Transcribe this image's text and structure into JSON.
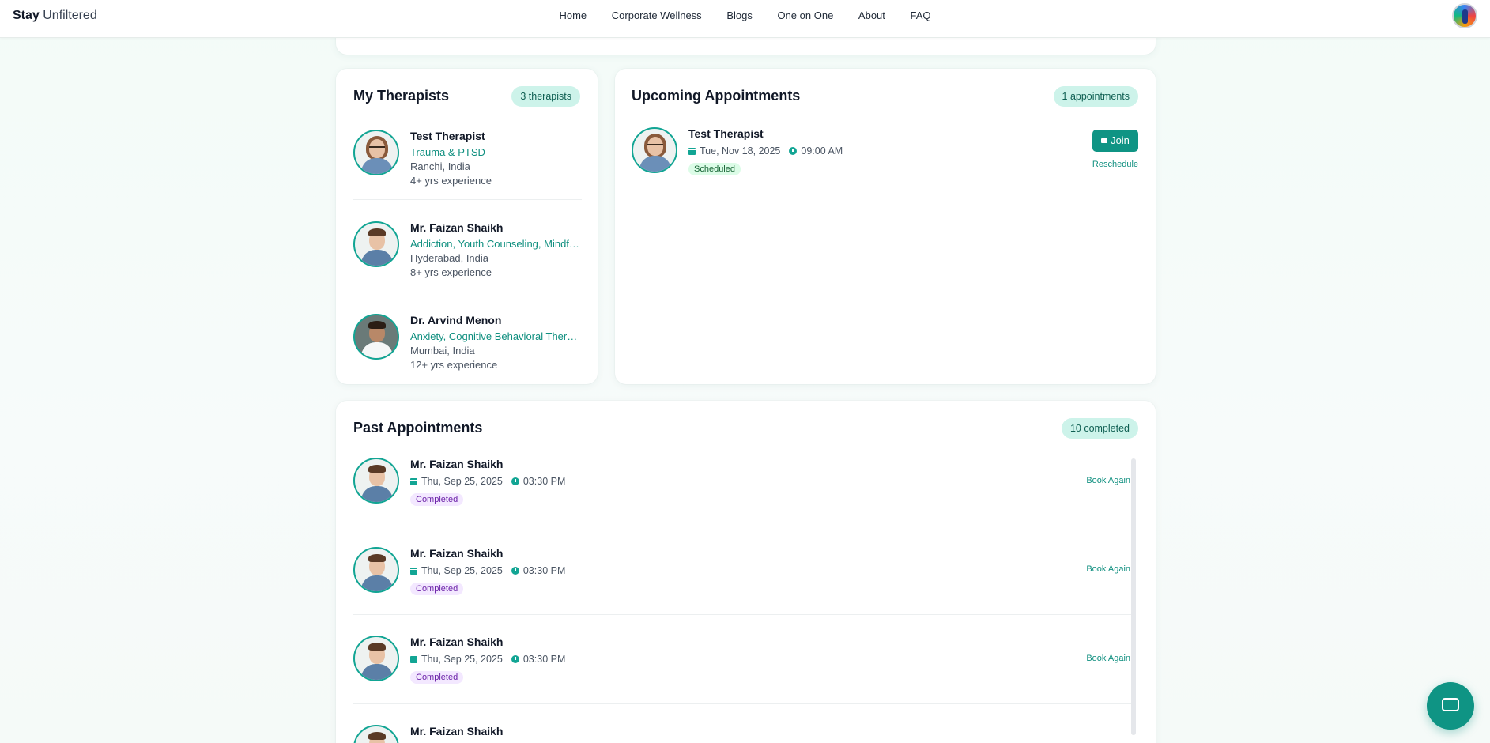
{
  "nav": {
    "brand_bold": "Stay",
    "brand_light": "Unfiltered",
    "links": [
      "Home",
      "Corporate Wellness",
      "Blogs",
      "One on One",
      "About",
      "FAQ"
    ]
  },
  "therapists": {
    "title": "My Therapists",
    "count_label": "3 therapists",
    "items": [
      {
        "name": "Test Therapist",
        "specialty": "Trauma & PTSD",
        "location": "Ranchi, India",
        "experience": "4+ yrs experience"
      },
      {
        "name": "Mr. Faizan Shaikh",
        "specialty": "Addiction, Youth Counseling, Mindfulness",
        "location": "Hyderabad, India",
        "experience": "8+ yrs experience"
      },
      {
        "name": "Dr. Arvind Menon",
        "specialty": "Anxiety, Cognitive Behavioral Therapy",
        "location": "Mumbai, India",
        "experience": "12+ yrs experience"
      }
    ]
  },
  "upcoming": {
    "title": "Upcoming Appointments",
    "count_label": "1 appointments",
    "items": [
      {
        "name": "Test Therapist",
        "date": "Tue, Nov 18, 2025",
        "time": "09:00 AM",
        "status": "Scheduled",
        "join_label": "Join",
        "reschedule_label": "Reschedule"
      }
    ]
  },
  "past": {
    "title": "Past Appointments",
    "count_label": "10 completed",
    "book_again_label": "Book Again",
    "items": [
      {
        "name": "Mr. Faizan Shaikh",
        "date": "Thu, Sep 25, 2025",
        "time": "03:30 PM",
        "status": "Completed"
      },
      {
        "name": "Mr. Faizan Shaikh",
        "date": "Thu, Sep 25, 2025",
        "time": "03:30 PM",
        "status": "Completed"
      },
      {
        "name": "Mr. Faizan Shaikh",
        "date": "Thu, Sep 25, 2025",
        "time": "03:30 PM",
        "status": "Completed"
      },
      {
        "name": "Mr. Faizan Shaikh"
      }
    ]
  }
}
